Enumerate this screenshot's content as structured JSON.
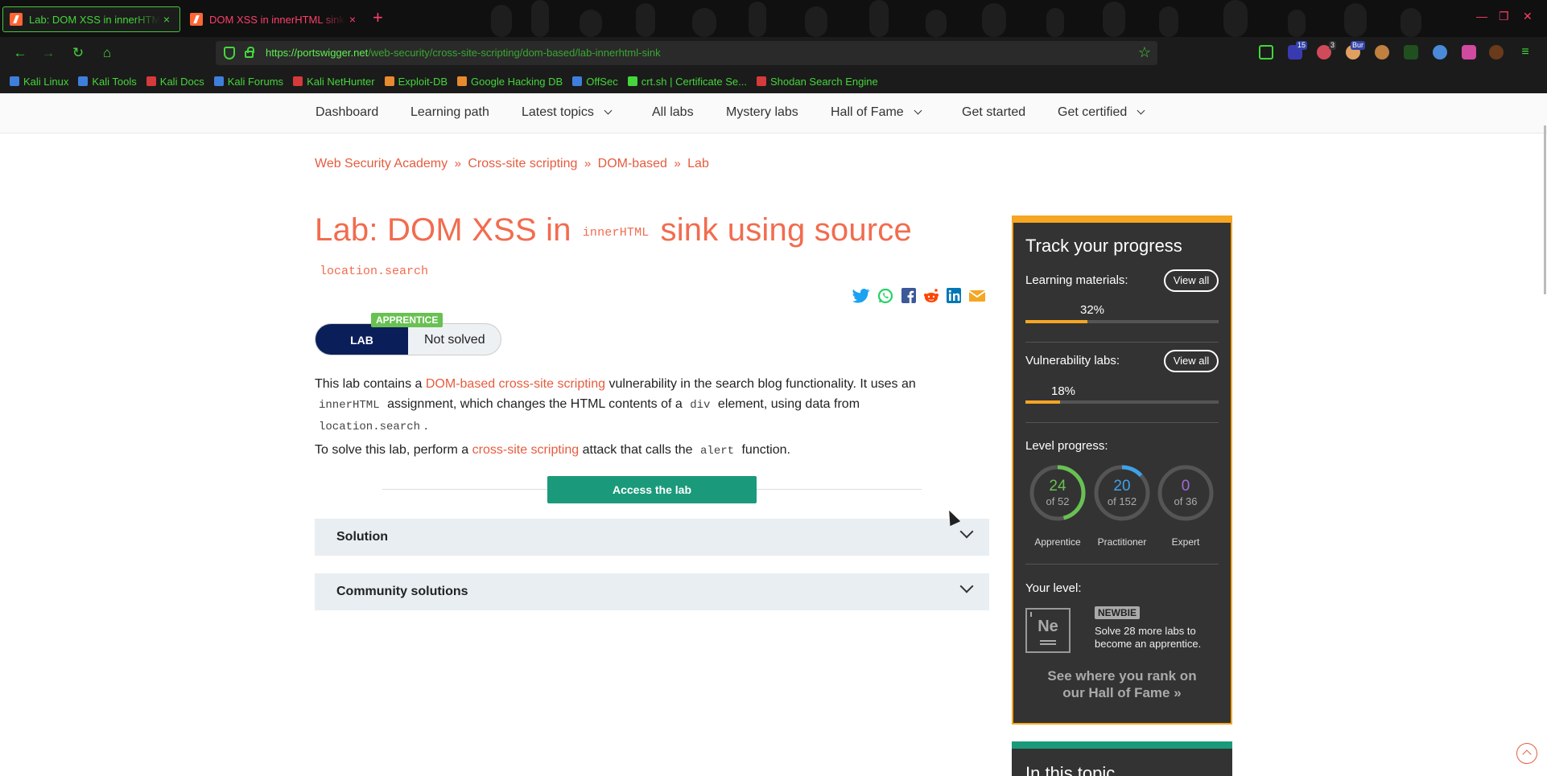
{
  "browser": {
    "tabs": [
      {
        "label": "Lab: DOM XSS in innerHTML sink using source location.search",
        "close": "×"
      },
      {
        "label": "DOM XSS in innerHTML sink using source location.search",
        "close": "×"
      }
    ],
    "new_tab": "+",
    "url_host": "https://portswigger.net",
    "url_path": "/web-security/cross-site-scripting/dom-based/lab-innerhtml-sink",
    "extension_badges": [
      "15",
      "3",
      "Bur"
    ],
    "bookmarks": [
      {
        "label": "Kali Linux",
        "color": "#3f7fdc"
      },
      {
        "label": "Kali Tools",
        "color": "#3f7fdc"
      },
      {
        "label": "Kali Docs",
        "color": "#d63a3a"
      },
      {
        "label": "Kali Forums",
        "color": "#3f7fdc"
      },
      {
        "label": "Kali NetHunter",
        "color": "#d63a3a"
      },
      {
        "label": "Exploit-DB",
        "color": "#e88a2f"
      },
      {
        "label": "Google Hacking DB",
        "color": "#e88a2f"
      },
      {
        "label": "OffSec",
        "color": "#3f7fdc"
      },
      {
        "label": "crt.sh | Certificate Se...",
        "color": "#44d63a"
      },
      {
        "label": "Shodan Search Engine",
        "color": "#d63a3a"
      }
    ]
  },
  "nav": {
    "items": [
      "Dashboard",
      "Learning path",
      "Latest topics",
      "All labs",
      "Mystery labs",
      "Hall of Fame",
      "Get started",
      "Get certified"
    ]
  },
  "breadcrumb": {
    "items": [
      "Web Security Academy",
      "Cross-site scripting",
      "DOM-based",
      "Lab"
    ],
    "sep": "»"
  },
  "lab": {
    "title_prefix": "Lab: DOM XSS in",
    "title_code": "innerHTML",
    "title_suffix": "sink using source",
    "title_code2": "location.search",
    "level": "APPRENTICE",
    "tag": "LAB",
    "status": "Not solved",
    "desc1_a": "This lab contains a",
    "desc1_link": "DOM-based cross-site scripting",
    "desc1_b": "vulnerability in the search blog functionality. It uses an",
    "desc1_code": "innerHTML",
    "desc1_c": "assignment, which changes the HTML contents of a",
    "desc1_code2": "div",
    "desc1_d": "element, using data from",
    "desc1_code3": "location.search",
    "desc1_e": ".",
    "desc2_a": "To solve this lab, perform a",
    "desc2_link": "cross-site scripting",
    "desc2_b": "attack that calls the",
    "desc2_code": "alert",
    "desc2_c": "function.",
    "access": "Access the lab",
    "accordions": [
      "Solution",
      "Community solutions"
    ]
  },
  "progress": {
    "title": "Track your progress",
    "learning_label": "Learning materials:",
    "learning_pct": "32%",
    "learning_value": 0.32,
    "vuln_label": "Vulnerability labs:",
    "vuln_pct": "18%",
    "vuln_value": 0.18,
    "view_all": "View all",
    "level_label": "Level progress:",
    "rings": [
      {
        "num": "24",
        "of": "of 52",
        "label": "Apprentice",
        "value": 0.4615,
        "color": "#68c152"
      },
      {
        "num": "20",
        "of": "of 152",
        "label": "Practitioner",
        "value": 0.1316,
        "color": "#3fa2e8"
      },
      {
        "num": "0",
        "of": "of 36",
        "label": "Expert",
        "value": 0,
        "color": "#a16ad8"
      }
    ],
    "your_level": "Your level:",
    "element_symbol": "Ne",
    "badge": "NEWBIE",
    "solve_text": "Solve 28 more labs to become an apprentice.",
    "rank_text": "See where you rank on our Hall of Fame",
    "rank_arrow": "»"
  },
  "in_topic": {
    "title": "In this topic"
  },
  "colors": {
    "accent": "#f26c4f",
    "lab_navy": "#0a1e5a",
    "access_green": "#1a9a7a",
    "progress_orange": "#f5a623",
    "browser_green": "#44d63a"
  }
}
